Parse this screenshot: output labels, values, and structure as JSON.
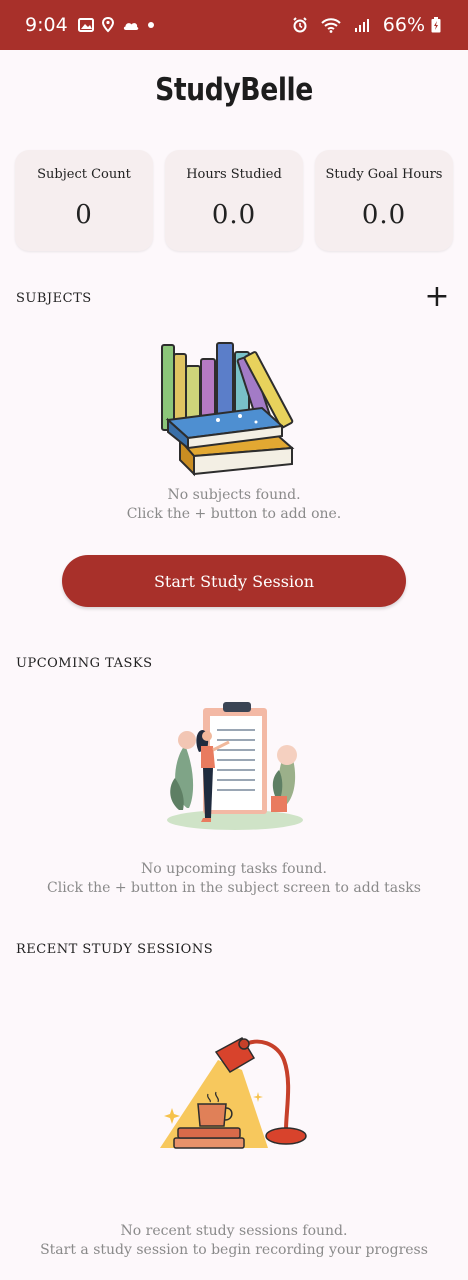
{
  "status_bar": {
    "time": "9:04",
    "battery": "66%",
    "icons": [
      "image-icon",
      "location-icon",
      "weather-icon",
      "dot-icon",
      "alarm-icon",
      "wifi-icon",
      "signal-icon",
      "battery-icon"
    ]
  },
  "app": {
    "title": "StudyBelle"
  },
  "stats": [
    {
      "label": "Subject Count",
      "value": "0"
    },
    {
      "label": "Hours Studied",
      "value": "0.0"
    },
    {
      "label": "Study Goal Hours",
      "value": "0.0"
    }
  ],
  "subjects": {
    "title": "SUBJECTS",
    "add_icon": "+",
    "empty_line1": "No subjects found.",
    "empty_line2": "Click the + button to add one."
  },
  "start_button": {
    "label": "Start Study Session"
  },
  "tasks": {
    "title": "UPCOMING TASKS",
    "empty_line1": "No upcoming tasks found.",
    "empty_line2": "Click the + button in the subject screen to add tasks"
  },
  "sessions": {
    "title": "RECENT STUDY SESSIONS",
    "empty_line1": "No recent study sessions found.",
    "empty_line2": "Start a study session to begin recording your progress"
  },
  "colors": {
    "primary": "#a8302a",
    "card": "#f6eeef",
    "background": "#fdf8fb",
    "muted_text": "#8a8a8a"
  }
}
